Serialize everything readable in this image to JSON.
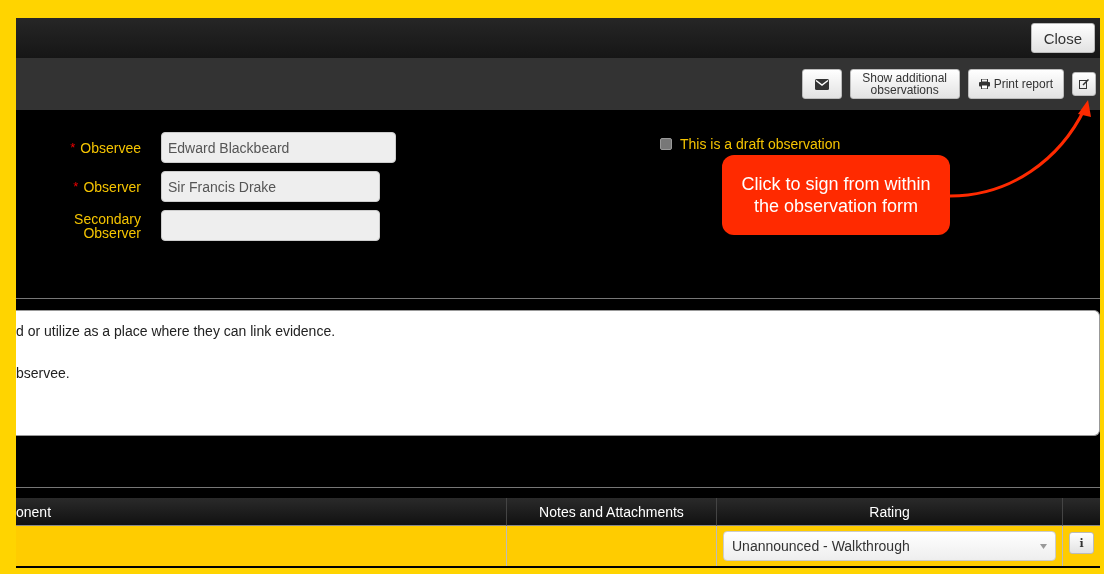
{
  "top_bar": {
    "close_button": "Close"
  },
  "toolbar": {
    "buttons": [
      {
        "kind": "email"
      },
      {
        "kind": "text",
        "label": "Show additional observations"
      },
      {
        "kind": "print",
        "label": "Print report"
      },
      {
        "kind": "sign"
      }
    ]
  },
  "form": {
    "fields": [
      {
        "label": "Observee",
        "required_mark": "*",
        "value": "Edward Blackbeard",
        "wide": true
      },
      {
        "label": "Observer",
        "required_mark": "*",
        "value": "Sir Francis Drake",
        "wide": false
      },
      {
        "label": "Secondary Observer",
        "wide": false
      }
    ],
    "draft": {
      "label": "This is a draft observation",
      "checked": false
    }
  },
  "callout": {
    "text": "Click to sign from within the observation form"
  },
  "description": {
    "lines": [
      "d or utilize as a place where they can link evidence.",
      "bservee."
    ]
  },
  "table": {
    "columns": [
      "onent",
      "Notes and Attachments",
      "Rating",
      ""
    ],
    "rows": [
      {
        "rating": "Unannounced - Walkthrough",
        "info": "i"
      }
    ]
  }
}
